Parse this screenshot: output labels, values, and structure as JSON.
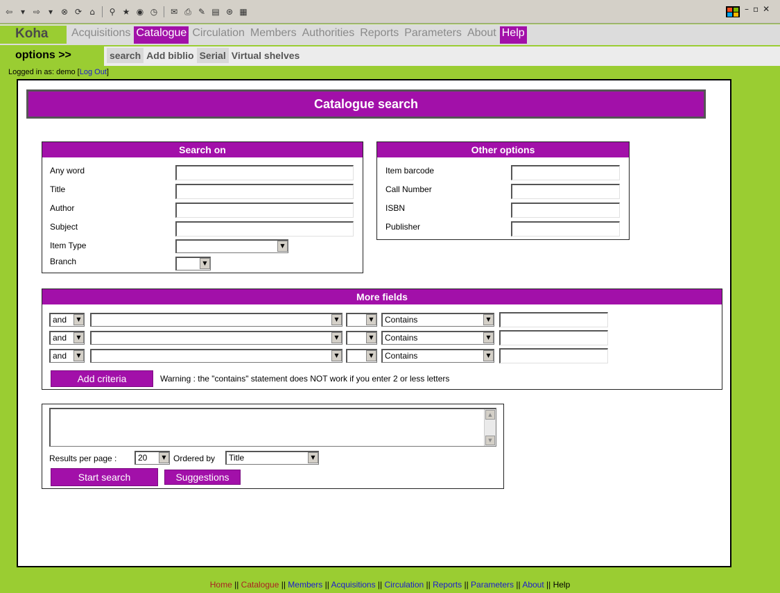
{
  "toolbar": {
    "icons": [
      "back-icon",
      "forward-icon",
      "stop-icon",
      "refresh-icon",
      "home-icon",
      "search-icon",
      "favorites-icon",
      "media-icon",
      "history-icon",
      "mail-icon",
      "print-icon",
      "edit-icon",
      "discuss-icon",
      "messenger-icon",
      "research-icon"
    ]
  },
  "menu": {
    "brand": "Koha",
    "items": [
      {
        "label": "Acquisitions",
        "active": false
      },
      {
        "label": "Catalogue",
        "active": true
      },
      {
        "label": "Circulation",
        "active": false
      },
      {
        "label": "Members",
        "active": false
      },
      {
        "label": "Authorities",
        "active": false
      },
      {
        "label": "Reports",
        "active": false
      },
      {
        "label": "Parameters",
        "active": false
      },
      {
        "label": "About",
        "active": false
      },
      {
        "label": "Help",
        "active": true
      }
    ]
  },
  "submenu": {
    "options": "options >>",
    "items": [
      "search",
      "Add biblio",
      "Serial",
      "Virtual shelves"
    ]
  },
  "login": {
    "prefix": "Logged in as: demo [",
    "logout": "Log Out",
    "suffix": "]"
  },
  "page_title": "Catalogue search",
  "search_on": {
    "heading": "Search on",
    "fields": [
      "Any word",
      "Title",
      "Author",
      "Subject"
    ],
    "item_type_label": "Item Type",
    "branch_label": "Branch"
  },
  "other_options": {
    "heading": "Other options",
    "fields": [
      "Item barcode",
      "Call Number",
      "ISBN",
      "Publisher"
    ]
  },
  "more_fields": {
    "heading": "More fields",
    "rows": [
      {
        "op": "and",
        "condition": "Contains"
      },
      {
        "op": "and",
        "condition": "Contains"
      },
      {
        "op": "and",
        "condition": "Contains"
      }
    ],
    "add_button": "Add criteria",
    "warning": "Warning : the \"contains\" statement does NOT work if you enter 2 or less letters"
  },
  "results": {
    "per_page_label": "Results per page :",
    "per_page_value": "20",
    "ordered_by_label": "Ordered by",
    "ordered_by_value": "Title",
    "start_button": "Start search",
    "suggestions_button": "Suggestions"
  },
  "footer": {
    "links": [
      "Home",
      "Catalogue",
      "Members",
      "Acquisitions",
      "Circulation",
      "Reports",
      "Parameters",
      "About",
      "Help"
    ],
    "separator": " || "
  },
  "colors": {
    "page_bg": "#9acd32",
    "accent": "#a210a9"
  }
}
